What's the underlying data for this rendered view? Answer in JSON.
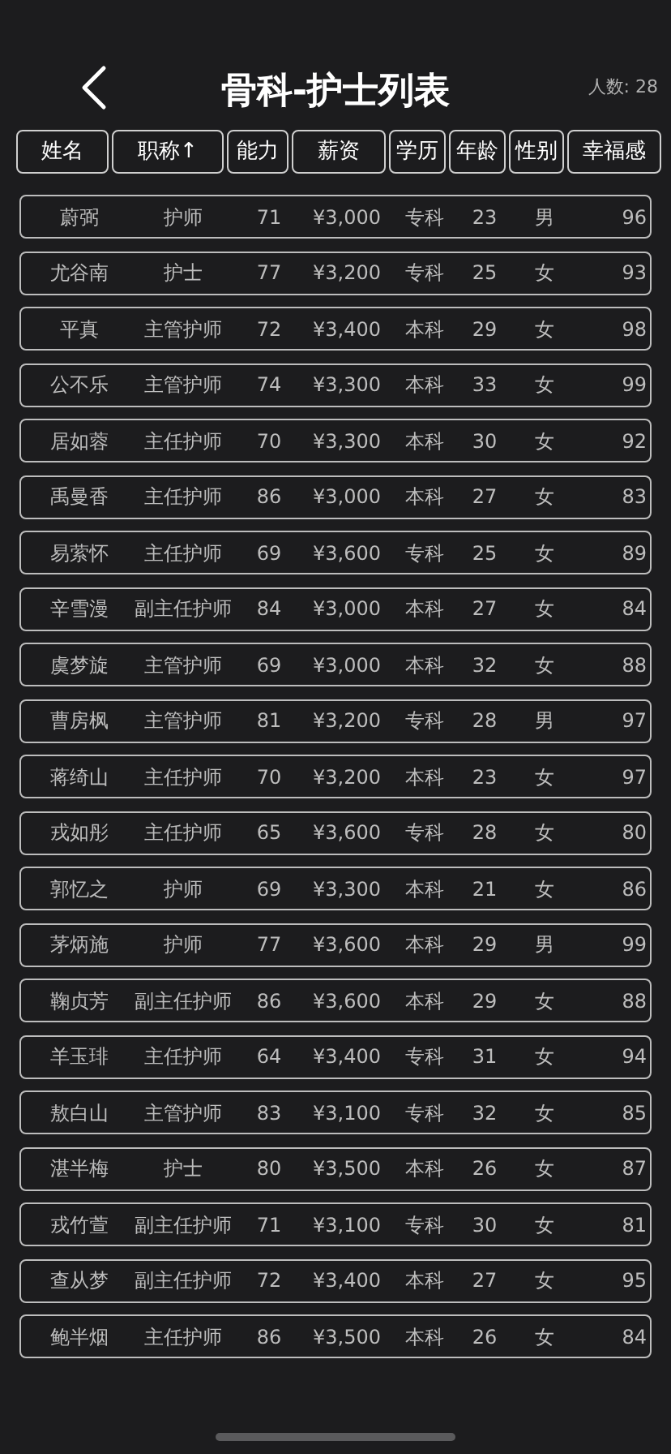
{
  "header": {
    "title": "骨科-护士列表",
    "count": "人数: 28"
  },
  "columns": [
    {
      "label": "姓名"
    },
    {
      "label": "职称↑"
    },
    {
      "label": "能力"
    },
    {
      "label": "薪资"
    },
    {
      "label": "学历"
    },
    {
      "label": "年龄"
    },
    {
      "label": "性别"
    },
    {
      "label": "幸福感"
    }
  ],
  "rows": [
    [
      "蔚弼",
      "护师",
      "71",
      "¥3,000",
      "专科",
      "23",
      "男",
      "96"
    ],
    [
      "尤谷南",
      "护士",
      "77",
      "¥3,200",
      "专科",
      "25",
      "女",
      "93"
    ],
    [
      "平真",
      "主管护师",
      "72",
      "¥3,400",
      "本科",
      "29",
      "女",
      "98"
    ],
    [
      "公不乐",
      "主管护师",
      "74",
      "¥3,300",
      "本科",
      "33",
      "女",
      "99"
    ],
    [
      "居如蓉",
      "主任护师",
      "70",
      "¥3,300",
      "本科",
      "30",
      "女",
      "92"
    ],
    [
      "禹曼香",
      "主任护师",
      "86",
      "¥3,000",
      "本科",
      "27",
      "女",
      "83"
    ],
    [
      "易萦怀",
      "主任护师",
      "69",
      "¥3,600",
      "专科",
      "25",
      "女",
      "89"
    ],
    [
      "辛雪漫",
      "副主任护师",
      "84",
      "¥3,000",
      "本科",
      "27",
      "女",
      "84"
    ],
    [
      "虞梦旋",
      "主管护师",
      "69",
      "¥3,000",
      "本科",
      "32",
      "女",
      "88"
    ],
    [
      "曹房枫",
      "主管护师",
      "81",
      "¥3,200",
      "专科",
      "28",
      "男",
      "97"
    ],
    [
      "蒋绮山",
      "主任护师",
      "70",
      "¥3,200",
      "本科",
      "23",
      "女",
      "97"
    ],
    [
      "戎如彤",
      "主任护师",
      "65",
      "¥3,600",
      "专科",
      "28",
      "女",
      "80"
    ],
    [
      "郭忆之",
      "护师",
      "69",
      "¥3,300",
      "本科",
      "21",
      "女",
      "86"
    ],
    [
      "茅炳施",
      "护师",
      "77",
      "¥3,600",
      "本科",
      "29",
      "男",
      "99"
    ],
    [
      "鞠贞芳",
      "副主任护师",
      "86",
      "¥3,600",
      "本科",
      "29",
      "女",
      "88"
    ],
    [
      "羊玉琲",
      "主任护师",
      "64",
      "¥3,400",
      "专科",
      "31",
      "女",
      "94"
    ],
    [
      "敖白山",
      "主管护师",
      "83",
      "¥3,100",
      "专科",
      "32",
      "女",
      "85"
    ],
    [
      "湛半梅",
      "护士",
      "80",
      "¥3,500",
      "本科",
      "26",
      "女",
      "87"
    ],
    [
      "戎竹萱",
      "副主任护师",
      "71",
      "¥3,100",
      "专科",
      "30",
      "女",
      "81"
    ],
    [
      "查从梦",
      "副主任护师",
      "72",
      "¥3,400",
      "本科",
      "27",
      "女",
      "95"
    ],
    [
      "鲍半烟",
      "主任护师",
      "86",
      "¥3,500",
      "本科",
      "26",
      "女",
      "84"
    ]
  ]
}
